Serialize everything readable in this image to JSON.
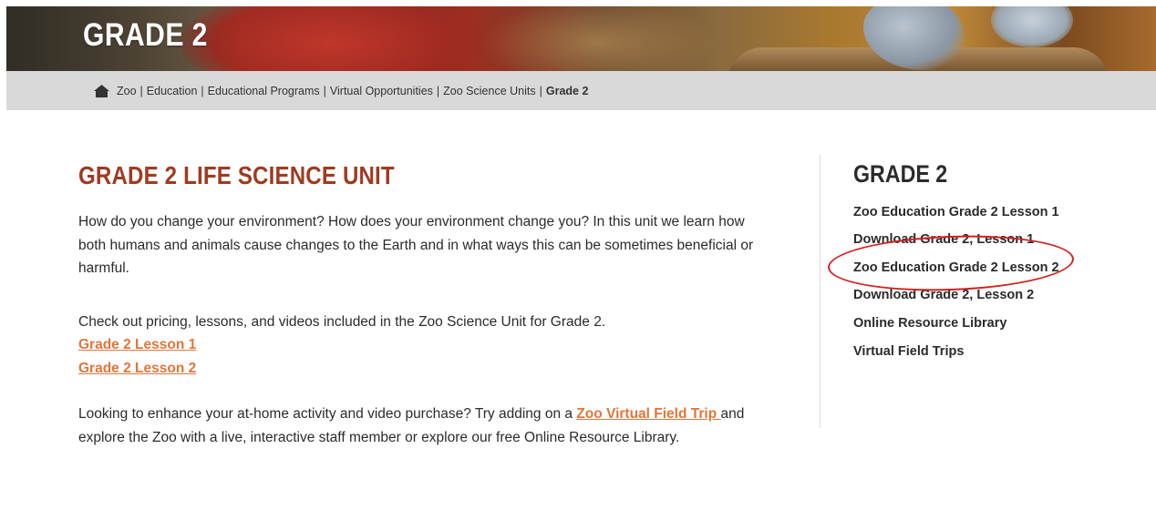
{
  "hero": {
    "title": "GRADE 2"
  },
  "breadcrumb": {
    "items": [
      "Zoo",
      "Education",
      "Educational Programs",
      "Virtual Opportunities",
      "Zoo Science Units"
    ],
    "current": "Grade 2",
    "separator": "|"
  },
  "main": {
    "heading": "GRADE 2 LIFE SCIENCE UNIT",
    "intro": "How do you change your environment? How does your environment change you? In this unit we learn how both humans and animals cause changes to the Earth and in what ways this can be sometimes beneficial or harmful.",
    "pricing_text": "Check out pricing, lessons, and videos included in the Zoo Science Unit for Grade 2.",
    "lesson_links": [
      "Grade 2 Lesson 1",
      "Grade 2 Lesson 2"
    ],
    "enhance_prefix": "Looking to enhance your at-home activity and video purchase? Try adding on a ",
    "enhance_link": "Zoo Virtual Field Trip ",
    "enhance_suffix": "and explore the Zoo with a live, interactive staff member or explore our free Online Resource Library."
  },
  "sidebar": {
    "title": "GRADE 2",
    "items": [
      "Zoo Education Grade 2 Lesson 1",
      "Download Grade 2, Lesson 1",
      "Zoo Education Grade 2 Lesson 2",
      "Download Grade 2, Lesson 2",
      "Online Resource Library",
      "Virtual Field Trips"
    ]
  },
  "colors": {
    "heading": "#9e3b21",
    "link": "#e0763a",
    "breadcrumb_bg": "#d9d9d9",
    "annotation": "#d41f1f"
  },
  "icons": {
    "breadcrumb_home": "home-icon"
  }
}
